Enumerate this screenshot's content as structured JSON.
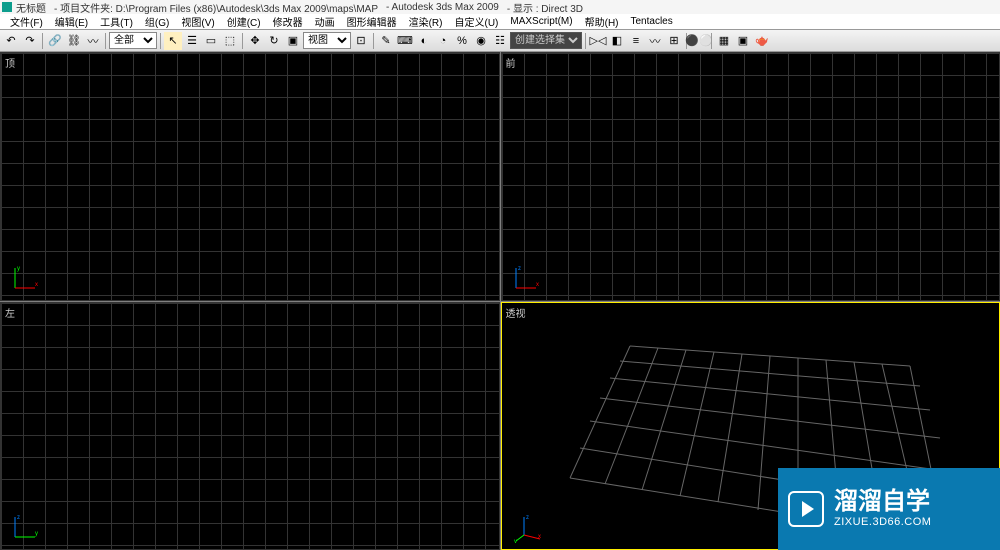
{
  "titlebar": {
    "untitled": "无标题",
    "folder_label": "- 项目文件夹: D:\\Program Files (x86)\\Autodesk\\3ds Max 2009\\maps\\MAP",
    "app": "- Autodesk 3ds Max  2009",
    "display": "- 显示 : Direct 3D"
  },
  "menu": {
    "file": "文件(F)",
    "edit": "编辑(E)",
    "tools": "工具(T)",
    "group": "组(G)",
    "views": "视图(V)",
    "create": "创建(C)",
    "modifiers": "修改器",
    "animation": "动画",
    "graph": "图形编辑器",
    "rendering": "渲染(R)",
    "customize": "自定义(U)",
    "maxscript": "MAXScript(M)",
    "help": "帮助(H)",
    "tentacles": "Tentacles"
  },
  "toolbar": {
    "selector_all": "全部",
    "view_mode": "视图",
    "selection_set": "创建选择集"
  },
  "viewports": {
    "top": "顶",
    "front": "前",
    "left": "左",
    "perspective": "透视"
  },
  "watermark": {
    "title": "溜溜自学",
    "url": "ZIXUE.3D66.COM"
  }
}
